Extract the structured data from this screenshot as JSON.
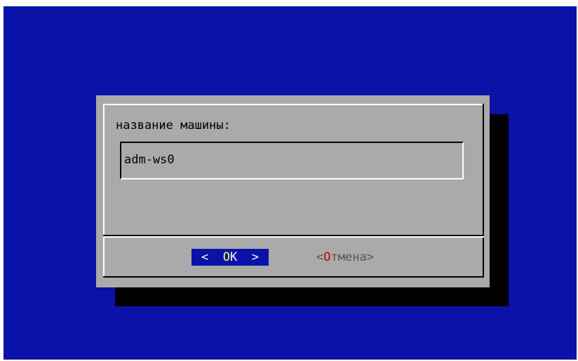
{
  "dialog": {
    "prompt": "название машины:",
    "input_value": "adm-ws0"
  },
  "buttons": {
    "ok": {
      "left_bracket": "<",
      "hotkey": "O",
      "rest": "K",
      "right_bracket": ">"
    },
    "cancel": {
      "left_bracket": "<",
      "hotkey": "О",
      "rest": "тмена",
      "right_bracket": ">"
    }
  },
  "colors": {
    "background": "#0a12a8",
    "dialog": "#aaaaaa",
    "shadow": "#000000",
    "selected_button_bg": "#0a12a8",
    "hotkey_selected": "#ffff55",
    "hotkey_unselected": "#c00000"
  }
}
